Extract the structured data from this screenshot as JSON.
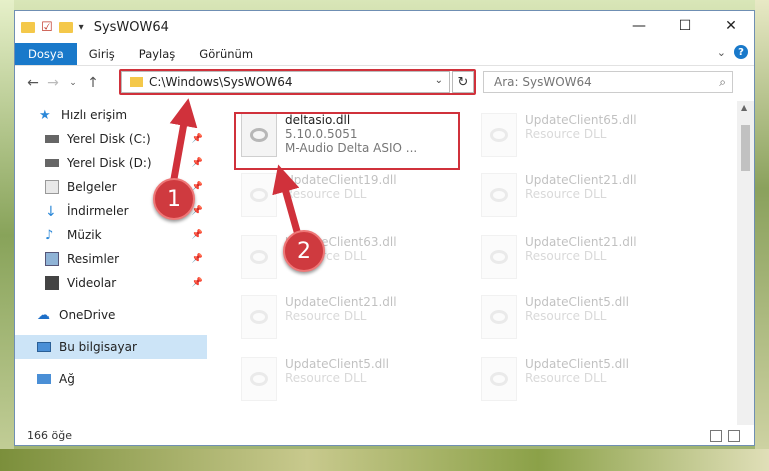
{
  "window": {
    "title": "SysWOW64"
  },
  "ribbon": {
    "tabs": [
      "Dosya",
      "Giriş",
      "Paylaş",
      "Görünüm"
    ]
  },
  "address": {
    "path": "C:\\Windows\\SysWOW64"
  },
  "search": {
    "placeholder": "Ara: SysWOW64"
  },
  "sidebar": {
    "items": [
      {
        "label": "Hızlı erişim",
        "icon": "star-icon"
      },
      {
        "label": "Yerel Disk (C:)",
        "icon": "drive-icon"
      },
      {
        "label": "Yerel Disk (D:)",
        "icon": "drive-icon"
      },
      {
        "label": "Belgeler",
        "icon": "documents-icon"
      },
      {
        "label": "İndirmeler",
        "icon": "download-icon"
      },
      {
        "label": "Müzik",
        "icon": "music-icon"
      },
      {
        "label": "Resimler",
        "icon": "pictures-icon"
      },
      {
        "label": "Videolar",
        "icon": "video-icon"
      },
      {
        "label": "OneDrive",
        "icon": "cloud-icon"
      },
      {
        "label": "Bu bilgisayar",
        "icon": "computer-icon"
      },
      {
        "label": "Ağ",
        "icon": "network-icon"
      }
    ]
  },
  "files": [
    {
      "name": "deltasio.dll",
      "line2": "5.10.0.5051",
      "line3": "M-Audio Delta ASIO ..."
    },
    {
      "name": "UpdateClient65.dll",
      "line2": "Resource DLL"
    },
    {
      "name": "UpdateClient19.dll",
      "line2": "Resource DLL"
    },
    {
      "name": "UpdateClient21.dll",
      "line2": "Resource DLL"
    },
    {
      "name": "UpdateClient63.dll",
      "line2": "Resource DLL"
    },
    {
      "name": "UpdateClient21.dll",
      "line2": "Resource DLL"
    },
    {
      "name": "UpdateClient21.dll",
      "line2": "Resource DLL"
    },
    {
      "name": "UpdateClient5.dll",
      "line2": "Resource DLL"
    },
    {
      "name": "UpdateClient5.dll",
      "line2": "Resource DLL"
    },
    {
      "name": "UpdateClient5.dll",
      "line2": "Resource DLL"
    }
  ],
  "status": {
    "count": "166 öğe"
  },
  "annotations": {
    "step1": "1",
    "step2": "2",
    "color": "#cf3a3f"
  }
}
